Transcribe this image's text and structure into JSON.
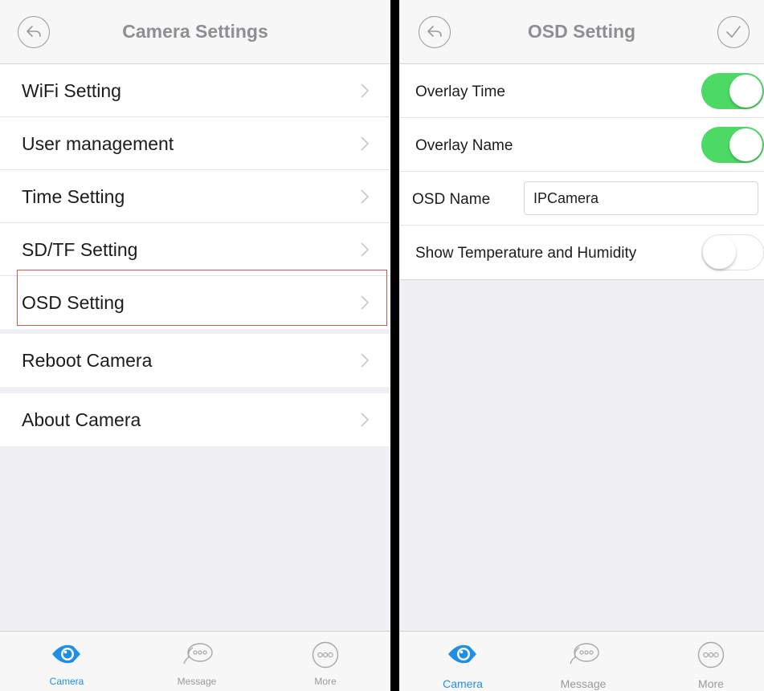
{
  "left": {
    "title": "Camera Settings",
    "menu_groups": [
      [
        "WiFi Setting",
        "User management",
        "Time Setting",
        "SD/TF Setting",
        "OSD Setting"
      ],
      [
        "Reboot Camera"
      ],
      [
        "About Camera"
      ]
    ],
    "highlighted_item": "OSD Setting"
  },
  "right": {
    "title": "OSD Setting",
    "overlay_time": {
      "label": "Overlay Time",
      "enabled": true
    },
    "overlay_name": {
      "label": "Overlay Name",
      "enabled": true
    },
    "osd_name": {
      "label": "OSD Name",
      "value": "IPCamera"
    },
    "show_temp_humidity": {
      "label": "Show Temperature and Humidity",
      "enabled": false
    }
  },
  "tabs": [
    {
      "label": "Camera",
      "icon": "eye-icon",
      "active": true
    },
    {
      "label": "Message",
      "icon": "chat-bubble-icon",
      "active": false
    },
    {
      "label": "More",
      "icon": "more-dots-icon",
      "active": false
    }
  ],
  "colors": {
    "accent": "#1e8ee8",
    "toggle_on": "#4cd964",
    "highlight_border": "#d9534f"
  }
}
